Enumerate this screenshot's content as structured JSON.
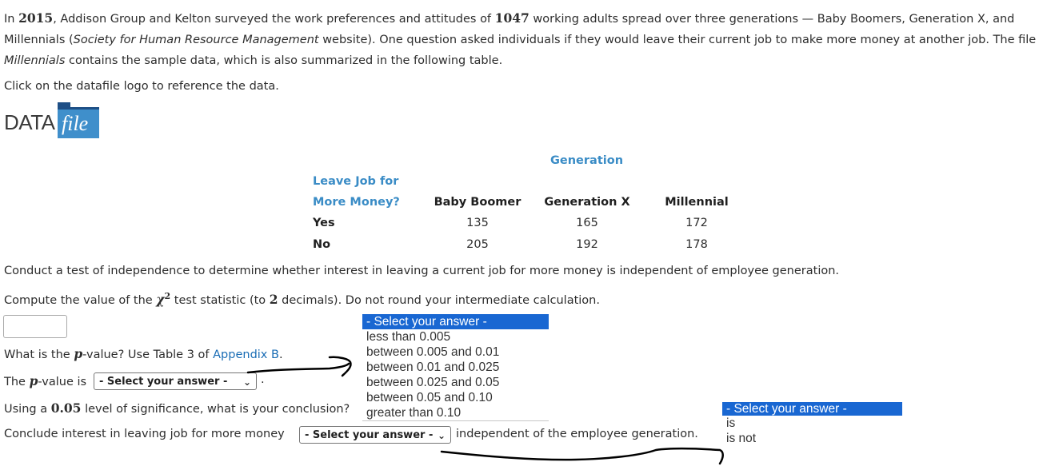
{
  "intro": {
    "p1": "In ",
    "year": "2015",
    "p2": ", Addison Group and Kelton surveyed the work preferences and attitudes of ",
    "count": "1047",
    "p3": " working adults spread over three generations — Baby Boomers, Generation X, and Millennials (",
    "source": "Society for Human Resource Management",
    "p4": " website). One question asked individuals if they would leave their current job to make more money at another job. The file ",
    "file_name": "Millennials",
    "p5": " contains the sample data, which is also summarized in the following table."
  },
  "datafile_instruction": "Click on the datafile logo to reference the data.",
  "logo": {
    "data_text": "DATA",
    "file_text": "file",
    "color": "#3f8fcb"
  },
  "table": {
    "group_header": "Generation",
    "row_header_line1": "Leave Job for",
    "row_header_line2": "More Money?",
    "columns": [
      "Baby Boomer",
      "Generation X",
      "Millennial"
    ],
    "rows": [
      {
        "label": "Yes",
        "values": [
          "135",
          "165",
          "172"
        ]
      },
      {
        "label": "No",
        "values": [
          "205",
          "192",
          "178"
        ]
      }
    ]
  },
  "q_independence": "Conduct a test of independence to determine whether interest in leaving a current job for more money is independent of employee generation.",
  "q_statistic": {
    "before": "Compute the value of the ",
    "symbol": "χ",
    "sup": "2",
    "middle": " test statistic (to ",
    "decimals": "2",
    "after": " decimals). Do not round your intermediate calculation.",
    "input_value": ""
  },
  "q_pvalue": {
    "before": "What is the ",
    "p": "p",
    "middle": "-value? Use Table 3 of ",
    "link": "Appendix B",
    "after": "."
  },
  "pvalue_line": {
    "before": "The ",
    "p": "p",
    "after": "-value is",
    "select_value": "- Select your answer -",
    "period": "."
  },
  "conclusion_q": {
    "before": "Using a ",
    "level": "0.05",
    "after": " level of significance, what is your conclusion?"
  },
  "conclude_line": {
    "before": "Conclude interest in leaving job for more money",
    "select_value": "- Select your answer -",
    "after": "independent of the employee generation."
  },
  "pvalue_dropdown": {
    "options": [
      "- Select your answer -",
      "less than 0.005",
      "between 0.005 and 0.01",
      "between 0.01 and 0.025",
      "between 0.025 and 0.05",
      "between 0.05 and 0.10",
      "greater than 0.10"
    ],
    "highlight_color": "#1967d2"
  },
  "conclusion_dropdown": {
    "options": [
      "- Select your answer -",
      "is",
      "is not"
    ],
    "highlight_color": "#1967d2"
  },
  "annotation_color": "#000000"
}
